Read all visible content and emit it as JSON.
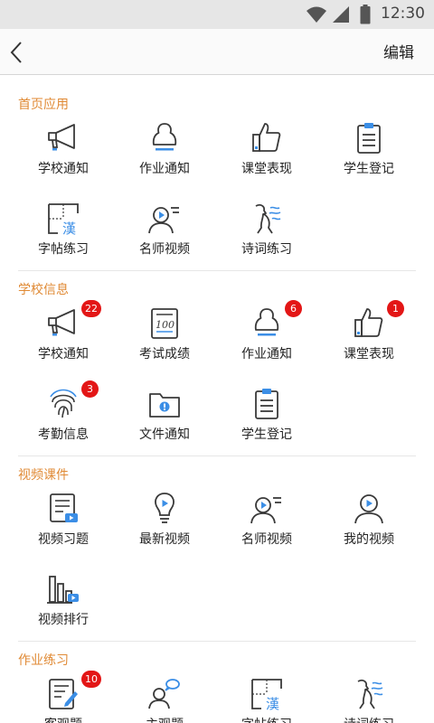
{
  "status_bar": {
    "time": "12:30"
  },
  "header": {
    "edit_label": "编辑"
  },
  "sections": [
    {
      "title": "首页应用",
      "items": [
        {
          "label": "学校通知",
          "icon": "megaphone-icon"
        },
        {
          "label": "作业通知",
          "icon": "person-icon"
        },
        {
          "label": "课堂表现",
          "icon": "thumbs-up-icon"
        },
        {
          "label": "学生登记",
          "icon": "clipboard-icon"
        },
        {
          "label": "字帖练习",
          "icon": "calligraphy-grid-icon"
        },
        {
          "label": "名师视频",
          "icon": "teacher-video-icon"
        },
        {
          "label": "诗词练习",
          "icon": "poetry-icon"
        }
      ]
    },
    {
      "title": "学校信息",
      "items": [
        {
          "label": "学校通知",
          "icon": "megaphone-icon",
          "badge": "22"
        },
        {
          "label": "考试成绩",
          "icon": "score-paper-icon"
        },
        {
          "label": "作业通知",
          "icon": "person-icon",
          "badge": "6"
        },
        {
          "label": "课堂表现",
          "icon": "thumbs-up-icon",
          "badge": "1"
        },
        {
          "label": "考勤信息",
          "icon": "fingerprint-icon",
          "badge": "3"
        },
        {
          "label": "文件通知",
          "icon": "folder-icon"
        },
        {
          "label": "学生登记",
          "icon": "clipboard-icon"
        }
      ]
    },
    {
      "title": "视频课件",
      "items": [
        {
          "label": "视频习题",
          "icon": "video-exercise-icon"
        },
        {
          "label": "最新视频",
          "icon": "lightbulb-icon"
        },
        {
          "label": "名师视频",
          "icon": "teacher-video-icon"
        },
        {
          "label": "我的视频",
          "icon": "my-video-icon"
        },
        {
          "label": "视频排行",
          "icon": "bar-ranking-icon"
        }
      ]
    },
    {
      "title": "作业练习",
      "items": [
        {
          "label": "客观题",
          "icon": "objective-edit-icon",
          "badge": "10"
        },
        {
          "label": "主观题",
          "icon": "subjective-chat-icon"
        },
        {
          "label": "字帖练习",
          "icon": "calligraphy-grid-icon"
        },
        {
          "label": "诗词练习",
          "icon": "poetry-icon"
        }
      ]
    }
  ]
}
